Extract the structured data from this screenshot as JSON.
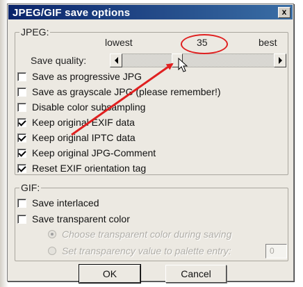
{
  "dialog": {
    "title": "JPEG/GIF save options",
    "close_symbol": "x"
  },
  "jpeg": {
    "group_label": "JPEG:",
    "scale_low": "lowest",
    "scale_high": "best",
    "quality_value": "35",
    "quality_label": "Save quality:",
    "checkboxes": [
      {
        "label": "Save as progressive JPG",
        "checked": false
      },
      {
        "label": "Save as grayscale JPG (please remember!)",
        "checked": false
      },
      {
        "label": "Disable color subsampling",
        "checked": false
      },
      {
        "label": "Keep original EXIF data",
        "checked": true
      },
      {
        "label": "Keep original IPTC data",
        "checked": true
      },
      {
        "label": "Keep original JPG-Comment",
        "checked": true
      },
      {
        "label": "Reset EXIF orientation tag",
        "checked": true
      }
    ]
  },
  "gif": {
    "group_label": "GIF:",
    "checkboxes": [
      {
        "label": "Save interlaced",
        "checked": false
      },
      {
        "label": "Save transparent color",
        "checked": false
      }
    ],
    "radios": [
      {
        "label": "Choose transparent color during saving",
        "selected": true
      },
      {
        "label": "Set transparency value to palette entry:",
        "selected": false
      }
    ],
    "palette_entry_value": "0"
  },
  "buttons": {
    "ok": "OK",
    "cancel": "Cancel"
  },
  "colors": {
    "annotation": "#e02020",
    "titlebar": "#0a246a"
  }
}
